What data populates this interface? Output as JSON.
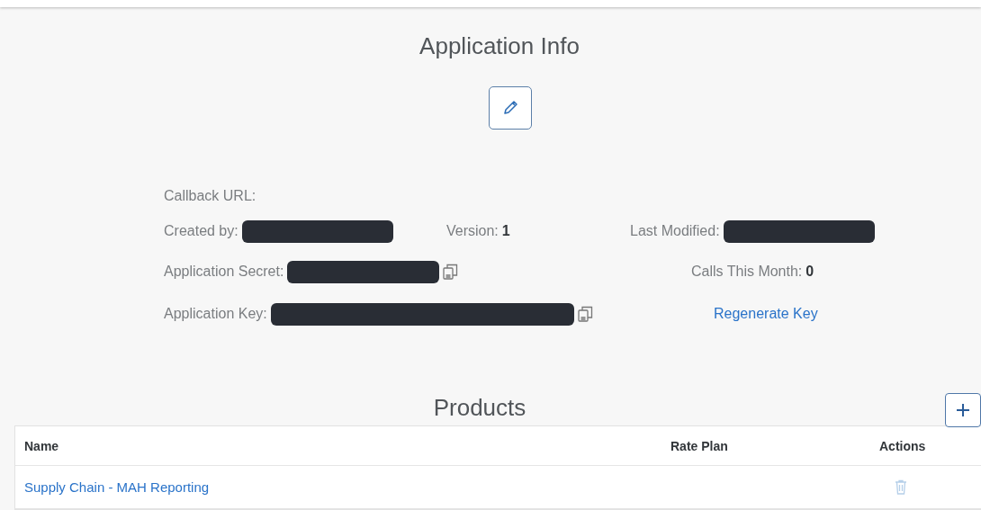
{
  "info": {
    "title": "Application Info",
    "fields": [
      {
        "label": "Callback URL:"
      },
      {
        "label": "Created by:",
        "redacted": true
      },
      {
        "label": "Version:",
        "value": "1"
      },
      {
        "label": "Last Modified:",
        "redacted": true
      },
      {
        "label": "Application Secret:",
        "redacted": true,
        "copyable": true
      },
      {
        "label": "Calls This Month:",
        "value": "0"
      },
      {
        "label": "Application Key:",
        "redacted": true,
        "copyable": true
      }
    ],
    "regenerate_link": "Regenerate Key"
  },
  "products": {
    "title": "Products",
    "table": {
      "columns": [
        "Name",
        "Rate Plan",
        "Actions"
      ],
      "rows": [
        {
          "name": "Supply Chain - MAH Reporting"
        }
      ]
    }
  }
}
